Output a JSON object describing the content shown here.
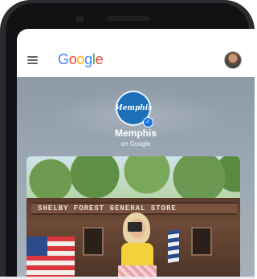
{
  "app": {
    "logo": {
      "letters": [
        {
          "char": "G",
          "color": "#4285F4"
        },
        {
          "char": "o",
          "color": "#EA4335"
        },
        {
          "char": "o",
          "color": "#FBBC05"
        },
        {
          "char": "g",
          "color": "#4285F4"
        },
        {
          "char": "l",
          "color": "#34A853"
        },
        {
          "char": "e",
          "color": "#EA4335"
        }
      ]
    },
    "menu_icon": "hamburger-menu-icon",
    "avatar_icon": "user-avatar"
  },
  "profile": {
    "badge_text": "Memphis",
    "name": "Memphis",
    "subtitle": "on Google",
    "verified_icon": "check-icon",
    "accent": "#1d6fb8"
  },
  "photo": {
    "sign_text": "SHELBY FOREST GENERAL STORE"
  }
}
